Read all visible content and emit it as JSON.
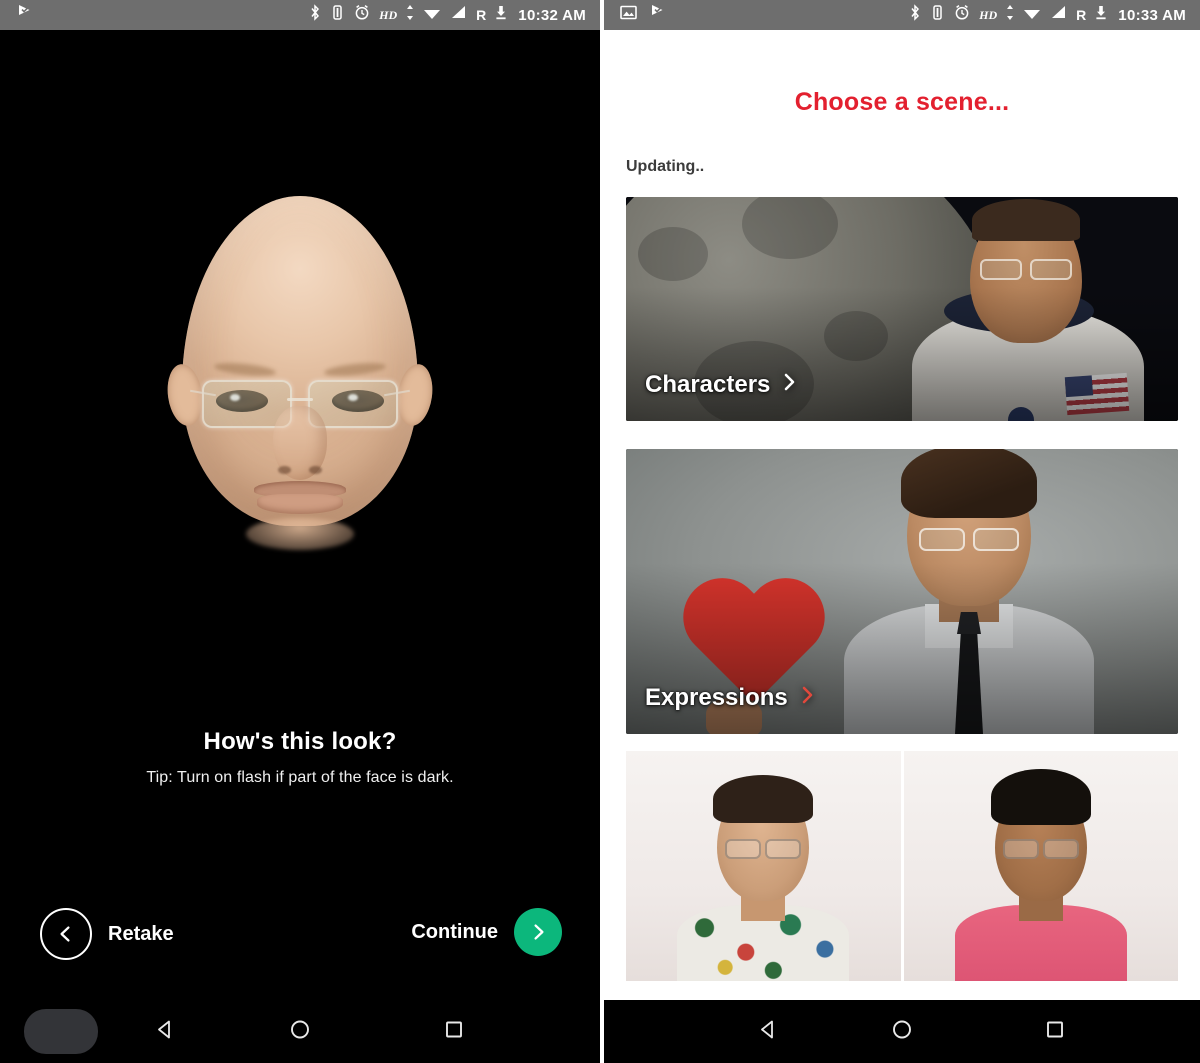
{
  "left_panel": {
    "status_bar": {
      "time": "10:32 AM",
      "icons": [
        "app-notification-icon",
        "bluetooth-icon",
        "vibrate-icon",
        "alarm-icon",
        "hd-icon",
        "wifi-icon",
        "signal-icon",
        "roaming-icon",
        "download-icon"
      ],
      "hd_label": "HD",
      "roaming_label": "R",
      "background": "#6e6e6e"
    },
    "preview": {
      "caption_title": "How's this look?",
      "caption_tip": "Tip: Turn on flash if part of the face is dark.",
      "background": "#000000"
    },
    "actions": {
      "retake_label": "Retake",
      "retake_icon": "chevron-left-circle-icon",
      "continue_label": "Continue",
      "continue_icon": "chevron-right-circle-icon",
      "continue_accent": "#0cb77c"
    },
    "nav_bar": {
      "back": "back-triangle-icon",
      "home": "home-circle-icon",
      "recents": "recents-square-icon",
      "thumbnail": "app-thumbnail"
    }
  },
  "right_panel": {
    "status_bar": {
      "time": "10:33 AM",
      "icons": [
        "image-icon",
        "app-notification-icon",
        "bluetooth-icon",
        "vibrate-icon",
        "alarm-icon",
        "hd-icon",
        "wifi-icon",
        "signal-icon",
        "roaming-icon",
        "download-icon"
      ],
      "hd_label": "HD",
      "roaming_label": "R",
      "background": "#6e6e6e"
    },
    "header": {
      "title": "Choose a scene...",
      "title_color": "#e3202f",
      "status_text": "Updating.."
    },
    "cards": [
      {
        "label": "Characters",
        "chevron": "chevron-right-icon",
        "scene": "astronaut-on-moon",
        "chevron_color": "#ffffff"
      },
      {
        "label": "Expressions",
        "chevron": "chevron-right-icon",
        "scene": "man-holding-red-heart",
        "chevron_color": "#e0483c"
      }
    ],
    "thumbnails": [
      {
        "scene": "man-in-floral-shirt"
      },
      {
        "scene": "man-in-pink-tshirt"
      }
    ],
    "nav_bar": {
      "back": "back-triangle-icon",
      "home": "home-circle-icon",
      "recents": "recents-square-icon"
    }
  }
}
